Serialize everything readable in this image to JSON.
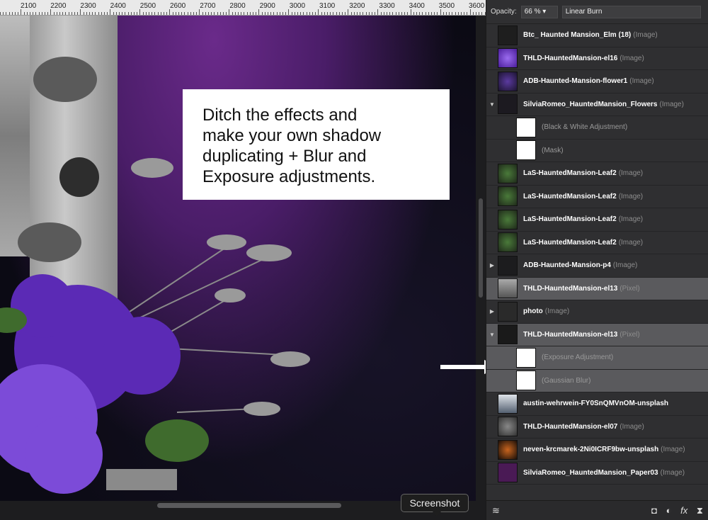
{
  "ruler": {
    "labels": [
      "2100",
      "2200",
      "2300",
      "2400",
      "2500",
      "2600",
      "2700",
      "2800",
      "2900",
      "3000",
      "3100",
      "3200",
      "3300",
      "3400",
      "3500",
      "3600"
    ]
  },
  "annotation": {
    "lines": [
      "Ditch the effects and",
      "make your own shadow",
      "duplicating + Blur and",
      "Exposure adjustments."
    ]
  },
  "tooltip": {
    "label": "Screenshot"
  },
  "layers_panel": {
    "opacity_label": "Opacity:",
    "opacity_value": "66 %",
    "blend_mode": "Linear Burn",
    "layers": [
      {
        "name": "Btc_ Haunted Mansion_Elm (18)",
        "type": "(Image)",
        "expander": "",
        "thumb": "bat",
        "selected": false,
        "child": false
      },
      {
        "name": "THLD-HauntedMansion-el16",
        "type": "(Image)",
        "expander": "",
        "thumb": "flower-purple",
        "selected": false,
        "child": false
      },
      {
        "name": "ADB-Haunted-Mansion-flower1",
        "type": "(Image)",
        "expander": "",
        "thumb": "flower-dark",
        "selected": false,
        "child": false
      },
      {
        "name": "SilviaRomeo_HauntedMansion_Flowers",
        "type": "(Image)",
        "expander": "▼",
        "thumb": "dark",
        "selected": false,
        "child": false
      },
      {
        "name": "(Black & White Adjustment)",
        "type": "",
        "expander": "",
        "thumb": "adjust",
        "selected": false,
        "child": true
      },
      {
        "name": "(Mask)",
        "type": "",
        "expander": "",
        "thumb": "mask",
        "selected": false,
        "child": true
      },
      {
        "name": "LaS-HauntedMansion-Leaf2",
        "type": "(Image)",
        "expander": "",
        "thumb": "leaf",
        "selected": false,
        "child": false
      },
      {
        "name": "LaS-HauntedMansion-Leaf2",
        "type": "(Image)",
        "expander": "",
        "thumb": "leaf",
        "selected": false,
        "child": false
      },
      {
        "name": "LaS-HauntedMansion-Leaf2",
        "type": "(Image)",
        "expander": "",
        "thumb": "leaf",
        "selected": false,
        "child": false
      },
      {
        "name": "LaS-HauntedMansion-Leaf2",
        "type": "(Image)",
        "expander": "",
        "thumb": "leaf",
        "selected": false,
        "child": false
      },
      {
        "name": "ADB-Haunted-Mansion-p4",
        "type": "(Image)",
        "expander": "▶",
        "thumb": "group3",
        "selected": false,
        "child": false
      },
      {
        "name": "THLD-HauntedMansion-el13",
        "type": "(Pixel)",
        "expander": "",
        "thumb": "frame",
        "selected": true,
        "child": false
      },
      {
        "name": "photo",
        "type": "(Image)",
        "expander": "▶",
        "thumb": "group4",
        "selected": false,
        "child": false
      },
      {
        "name": "THLD-HauntedMansion-el13",
        "type": "(Pixel)",
        "expander": "▼",
        "thumb": "frame-dark",
        "selected": true,
        "child": false
      },
      {
        "name": "(Exposure Adjustment)",
        "type": "",
        "expander": "",
        "thumb": "adjust",
        "selected": true,
        "child": true
      },
      {
        "name": "(Gaussian Blur)",
        "type": "",
        "expander": "",
        "thumb": "blur",
        "selected": true,
        "child": true
      },
      {
        "name": "austin-wehrwein-FY0SnQMVnOM-unsplash",
        "type": "",
        "expander": "",
        "thumb": "forest",
        "selected": false,
        "child": false
      },
      {
        "name": "THLD-HauntedMansion-el07",
        "type": "(Image)",
        "expander": "",
        "thumb": "clock",
        "selected": false,
        "child": false
      },
      {
        "name": "neven-krcmarek-2Ni0ICRF9bw-unsplash",
        "type": "(Image)",
        "expander": "",
        "thumb": "pumpkin",
        "selected": false,
        "child": false
      },
      {
        "name": "SilviaRomeo_HauntedMansion_Paper03",
        "type": "(Image)",
        "expander": "",
        "thumb": "paper",
        "selected": false,
        "child": false
      }
    ],
    "bottom_icons": [
      "layers-icon",
      "mask-icon",
      "adjustment-icon",
      "fx-icon",
      "filter-icon"
    ]
  }
}
